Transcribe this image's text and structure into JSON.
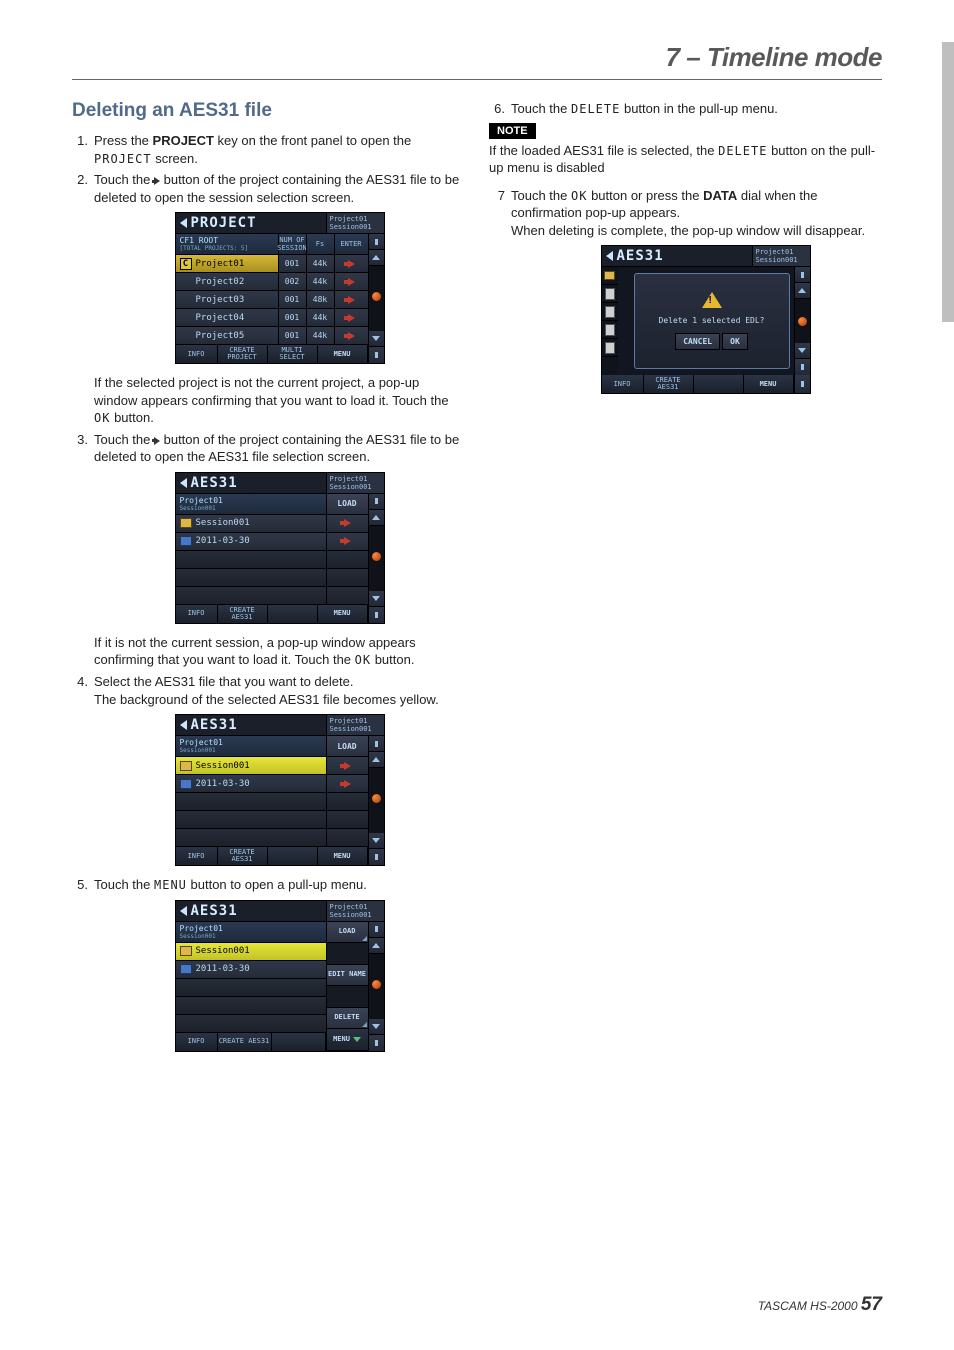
{
  "chapter": "7 – Timeline mode",
  "section_title": "Deleting an AES31 file",
  "steps": {
    "s1": {
      "n": "1.",
      "t1": "Press the ",
      "bold": "PROJECT",
      "t2": " key on the front panel to open the ",
      "mono": "PROJECT",
      "t3": " screen."
    },
    "s2": {
      "n": "2.",
      "t1": "Touch the ",
      "t2": " button of the project containing the AES31 file to be deleted to open the session selection screen."
    },
    "s2note": "If the selected project is not the current project, a pop-up window appears confirming that you want to load it. Touch the OK button.",
    "s3": {
      "n": "3.",
      "t1": "Touch the ",
      "t2": " button of the project containing the AES31 file to be deleted to open the AES31 file selection screen."
    },
    "s3note": "If it is not the current session, a pop-up window appears confirming that you want to load it. Touch the OK button.",
    "s4": {
      "n": "4.",
      "t1": "Select the AES31 file that you want to delete.",
      "t2": "The background of the selected AES31 file becomes yellow."
    },
    "s5": {
      "n": "5.",
      "t1": "Touch the ",
      "mono": "MENU",
      "t2": " button to open a pull-up menu."
    },
    "s6": {
      "n": "6.",
      "t1": "Touch the ",
      "mono": "DELETE",
      "t2": " button in the pull-up menu."
    },
    "s6note_badge": "NOTE",
    "s6note": "If the loaded AES31 file is selected, the DELETE button on the pull-up menu is disabled",
    "s7": {
      "n": "7",
      "t1": "Touch the ",
      "mono": "OK",
      "t2": " button or press the ",
      "bold": "DATA",
      "t3": " dial when the confirmation pop-up appears.",
      "t4": "When deleting is complete, the pop-up window will disappear."
    }
  },
  "lcd_project": {
    "title": "PROJECT",
    "sub1": "Project01",
    "sub2": "Session001",
    "path": "CF1 ROOT",
    "path_tiny": "[TOTAL PROJECTS: 5]",
    "h1": "NUM OF SESSION",
    "h2": "Fs",
    "h3": "ENTER",
    "rows": [
      {
        "name": "Project01",
        "num": "001",
        "fs": "44k",
        "current": true
      },
      {
        "name": "Project02",
        "num": "002",
        "fs": "44k"
      },
      {
        "name": "Project03",
        "num": "001",
        "fs": "48k"
      },
      {
        "name": "Project04",
        "num": "001",
        "fs": "44k"
      },
      {
        "name": "Project05",
        "num": "001",
        "fs": "44k"
      }
    ],
    "b_info": "INFO",
    "b_create": "CREATE PROJECT",
    "b_multi": "MULTI SELECT",
    "b_menu": "MENU"
  },
  "lcd_aes31_a": {
    "title": "AES31",
    "sub1": "Project01",
    "sub2": "Session001",
    "path1": "Project01",
    "path2": "Session001",
    "load": "LOAD",
    "rows": [
      {
        "name": "Session001",
        "type": "folder"
      },
      {
        "name": "2011-03-30",
        "type": "folder-blue"
      }
    ],
    "b_info": "INFO",
    "b_create": "CREATE AES31",
    "b_menu": "MENU"
  },
  "lcd_aes31_b": {
    "title": "AES31",
    "sub1": "Project01",
    "sub2": "Session001",
    "path1": "Project01",
    "path2": "Session001",
    "load": "LOAD",
    "rows": [
      {
        "name": "Session001",
        "type": "folder",
        "selected": true
      },
      {
        "name": "2011-03-30",
        "type": "folder-blue"
      }
    ],
    "b_info": "INFO",
    "b_create": "CREATE AES31",
    "b_menu": "MENU"
  },
  "lcd_aes31_menu": {
    "title": "AES31",
    "sub1": "Project01",
    "sub2": "Session001",
    "path1": "Project01",
    "path2": "Session001",
    "rows": [
      {
        "name": "Session001",
        "type": "folder",
        "selected": true
      },
      {
        "name": "2011-03-30",
        "type": "folder-blue"
      }
    ],
    "pm_load": "LOAD",
    "pm_edit": "EDIT NAME",
    "pm_delete": "DELETE",
    "b_info": "INFO",
    "b_create": "CREATE AES31",
    "b_menu": "MENU"
  },
  "lcd_confirm": {
    "title": "AES31",
    "sub1": "Project01",
    "sub2": "Session001",
    "dialog_text": "Delete 1 selected EDL?",
    "cancel": "CANCEL",
    "ok": "OK",
    "b_info": "INFO",
    "b_create": "CREATE AES31",
    "b_menu": "MENU"
  },
  "footer": {
    "brand": "TASCAM  HS-2000",
    "page": "57"
  }
}
